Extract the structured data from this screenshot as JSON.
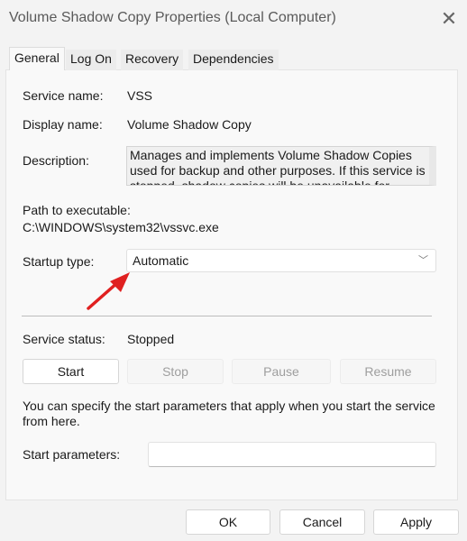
{
  "window": {
    "title": "Volume Shadow Copy Properties (Local Computer)",
    "close_icon": "close-icon"
  },
  "tabs": [
    {
      "label": "General",
      "active": true
    },
    {
      "label": "Log On",
      "active": false
    },
    {
      "label": "Recovery",
      "active": false
    },
    {
      "label": "Dependencies",
      "active": false
    }
  ],
  "general": {
    "service_name_label": "Service name:",
    "service_name": "VSS",
    "display_name_label": "Display name:",
    "display_name": "Volume Shadow Copy",
    "description_label": "Description:",
    "description": "Manages and implements Volume Shadow Copies used for backup and other purposes. If this service is stopped, shadow copies will be unavailable for",
    "path_label": "Path to executable:",
    "path": "C:\\WINDOWS\\system32\\vssvc.exe",
    "startup_type_label": "Startup type:",
    "startup_type": "Automatic",
    "service_status_label": "Service status:",
    "service_status": "Stopped",
    "buttons": [
      {
        "label": "Start",
        "enabled": true
      },
      {
        "label": "Stop",
        "enabled": false
      },
      {
        "label": "Pause",
        "enabled": false
      },
      {
        "label": "Resume",
        "enabled": false
      }
    ],
    "hint": "You can specify the start parameters that apply when you start the service from here.",
    "start_params_label": "Start parameters:",
    "start_params_value": ""
  },
  "footer": {
    "ok": "OK",
    "cancel": "Cancel",
    "apply": "Apply"
  },
  "annotation": {
    "arrow_color": "#e02020"
  }
}
